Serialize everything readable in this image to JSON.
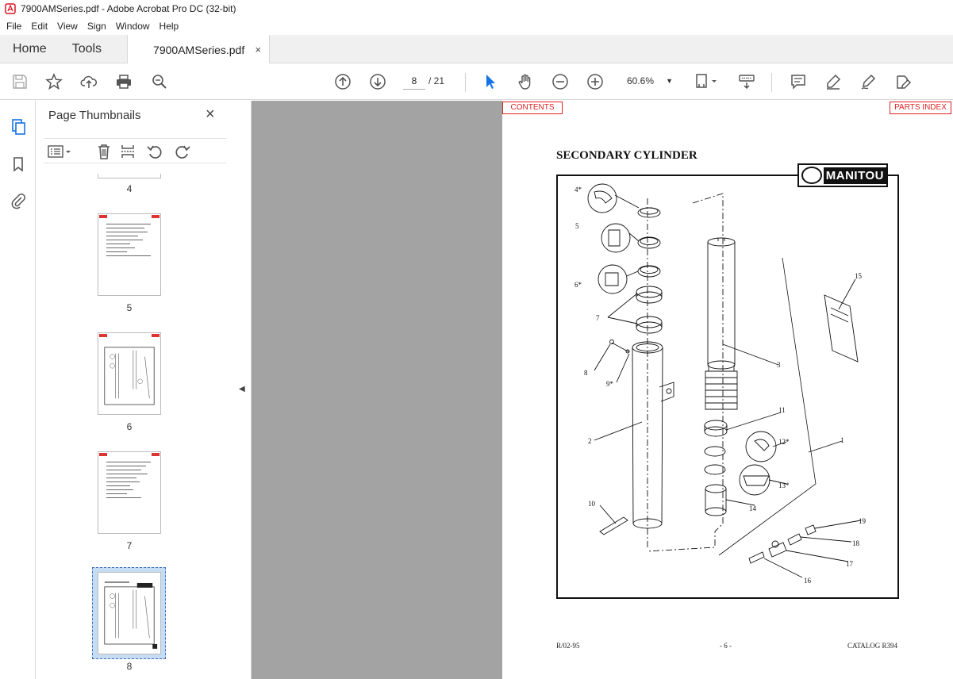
{
  "window": {
    "title": "7900AMSeries.pdf - Adobe Acrobat Pro DC (32-bit)"
  },
  "menu": [
    "File",
    "Edit",
    "View",
    "Sign",
    "Window",
    "Help"
  ],
  "tabs": {
    "home": "Home",
    "tools": "Tools",
    "document": "7900AMSeries.pdf",
    "close": "×"
  },
  "toolbar": {
    "current_page": "8",
    "page_total": "/ 21",
    "zoom": "60.6%"
  },
  "sidebar": {
    "title": "Page Thumbnails",
    "close": "×",
    "thumbnails": [
      {
        "label": "4"
      },
      {
        "label": "5"
      },
      {
        "label": "6"
      },
      {
        "label": "7"
      },
      {
        "label": "8",
        "selected": true
      }
    ]
  },
  "document": {
    "links": {
      "contents": "CONTENTS",
      "parts_index": "PARTS INDEX"
    },
    "title": "SECONDARY CYLINDER",
    "logo_text": "MANITOU",
    "part_labels": [
      "4*",
      "5",
      "6*",
      "7",
      "8",
      "9*",
      "2",
      "10",
      "3",
      "15",
      "11",
      "12*",
      "1",
      "13*",
      "14",
      "19",
      "18",
      "17",
      "16"
    ],
    "footer": {
      "left": "R/02-95",
      "center": "- 6 -",
      "right": "CATALOG R394"
    }
  },
  "colors": {
    "accent": "#1473e6",
    "link_red": "#dd2222",
    "viewer_bg": "#a3a3a3"
  }
}
